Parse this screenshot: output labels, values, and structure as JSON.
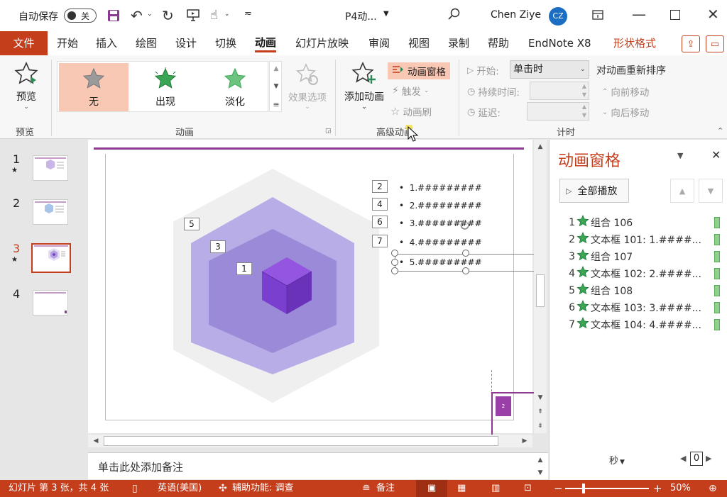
{
  "titlebar": {
    "autosave_label": "自动保存",
    "autosave_state": "关",
    "doc_title": "P4动...",
    "user_name": "Chen Ziye",
    "user_initials": "CZ"
  },
  "tabs": [
    {
      "label": "文件"
    },
    {
      "label": "开始"
    },
    {
      "label": "插入"
    },
    {
      "label": "绘图"
    },
    {
      "label": "设计"
    },
    {
      "label": "切换"
    },
    {
      "label": "动画"
    },
    {
      "label": "幻灯片放映"
    },
    {
      "label": "审阅"
    },
    {
      "label": "视图"
    },
    {
      "label": "录制"
    },
    {
      "label": "帮助"
    },
    {
      "label": "EndNote X8"
    },
    {
      "label": "形状格式"
    }
  ],
  "ribbon": {
    "preview": {
      "button": "预览",
      "group": "预览"
    },
    "animation": {
      "group": "动画",
      "items": [
        {
          "label": "无"
        },
        {
          "label": "出现"
        },
        {
          "label": "淡化"
        }
      ],
      "effect_options": "效果选项"
    },
    "advanced": {
      "group": "高级动画",
      "add_animation": "添加动画",
      "animation_pane": "动画窗格",
      "trigger": "触发",
      "painter": "动画刷"
    },
    "timing": {
      "group": "计时",
      "start_label": "开始:",
      "start_value": "单击时",
      "duration_label": "持续时间:",
      "delay_label": "延迟:",
      "reorder_title": "对动画重新排序",
      "move_earlier": "向前移动",
      "move_later": "向后移动"
    }
  },
  "thumbnails": [
    {
      "number": "1",
      "star": "★"
    },
    {
      "number": "2",
      "star": ""
    },
    {
      "number": "3",
      "star": "★"
    },
    {
      "number": "4",
      "star": ""
    }
  ],
  "slide": {
    "numbers": [
      "5",
      "3",
      "1",
      "2",
      "4",
      "6",
      "7"
    ],
    "bullets": [
      "1.#########",
      "2.#########",
      "3.#########",
      "4.#########",
      "5.#########"
    ],
    "mini_number": "2"
  },
  "notes_placeholder": "单击此处添加备注",
  "anim_pane": {
    "title": "动画窗格",
    "play_all": "全部播放",
    "items": [
      {
        "num": "1",
        "label": "组合 106"
      },
      {
        "num": "2",
        "label": "文本框 101: 1.####..."
      },
      {
        "num": "3",
        "label": "组合 107"
      },
      {
        "num": "4",
        "label": "文本框 102: 2.####..."
      },
      {
        "num": "5",
        "label": "组合 108"
      },
      {
        "num": "6",
        "label": "文本框 103: 3.####..."
      },
      {
        "num": "7",
        "label": "文本框 104: 4.####..."
      }
    ],
    "seconds_label": "秒",
    "timeline_value": "0"
  },
  "status": {
    "slide_info": "幻灯片 第 3 张，共 4 张",
    "language": "英语(美国)",
    "accessibility": "辅助功能: 调查",
    "notes": "备注",
    "zoom": "50%"
  },
  "colors": {
    "accent": "#c43e1c",
    "purple": "#8b3a8f",
    "star_green": "#3aa655"
  }
}
